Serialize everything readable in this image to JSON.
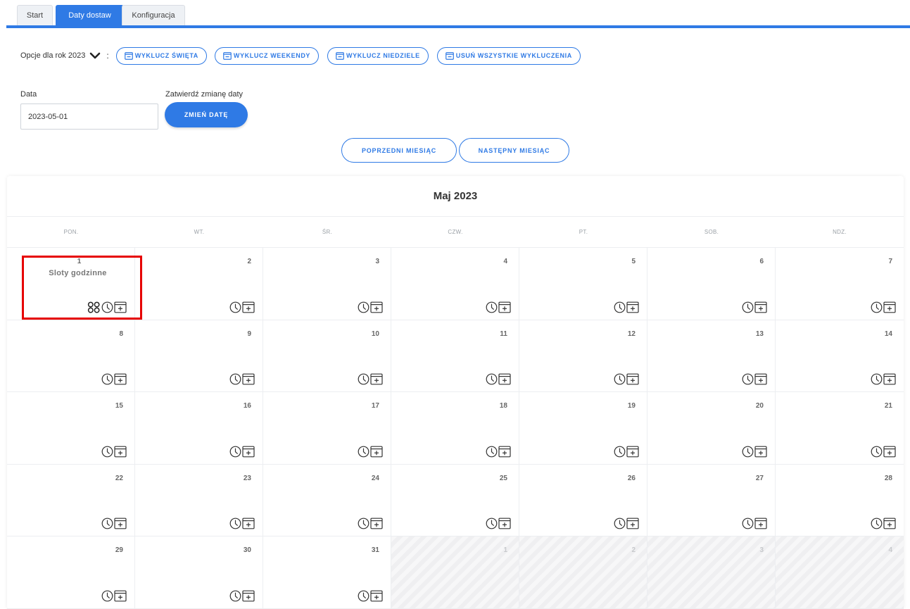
{
  "tabs": [
    {
      "label": "Start",
      "active": false
    },
    {
      "label": "Daty dostaw",
      "active": true
    },
    {
      "label": "Konfiguracja",
      "active": false
    }
  ],
  "options": {
    "label": "Opcje dla rok 2023",
    "colon": ":",
    "buttons": [
      "WYKLUCZ ŚWIĘTA",
      "WYKLUCZ WEEKENDY",
      "WYKLUCZ NIEDZIELE",
      "USUŃ WSZYSTKIE WYKLUCZENIA"
    ]
  },
  "date_form": {
    "date_label": "Data",
    "date_value": "2023-05-01",
    "confirm_label": "Zatwierdź zmianę daty",
    "change_button": "ZMIEŃ DATĘ"
  },
  "month_nav": {
    "prev": "POPRZEDNI MIESIĄC",
    "next": "NASTĘPNY MIESIĄC"
  },
  "calendar": {
    "title": "Maj 2023",
    "weekdays": [
      "PON.",
      "WT.",
      "ŚR.",
      "CZW.",
      "PT.",
      "SOB.",
      "NDZ."
    ],
    "slot_label": "Sloty godzinne",
    "days": [
      "1",
      "2",
      "3",
      "4",
      "5",
      "6",
      "7",
      "8",
      "9",
      "10",
      "11",
      "12",
      "13",
      "14",
      "15",
      "16",
      "17",
      "18",
      "19",
      "20",
      "21",
      "22",
      "23",
      "24",
      "25",
      "26",
      "27",
      "28",
      "29",
      "30",
      "31",
      "1",
      "2",
      "3",
      "4"
    ],
    "outside_from_index": 31
  },
  "colors": {
    "accent": "#2f7ae5",
    "highlight": "#e60000"
  }
}
